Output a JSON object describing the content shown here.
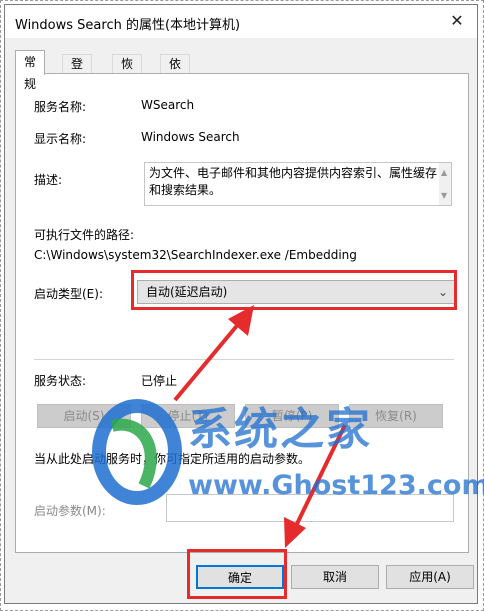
{
  "window": {
    "title": "Windows Search 的属性(本地计算机)"
  },
  "tabs": [
    "常规",
    "登录",
    "恢复",
    "依存关系"
  ],
  "general": {
    "service_name_label": "服务名称:",
    "service_name_value": "WSearch",
    "display_name_label": "显示名称:",
    "display_name_value": "Windows Search",
    "description_label": "描述:",
    "description_value": "为文件、电子邮件和其他内容提供内容索引、属性缓存和搜索结果。",
    "path_label": "可执行文件的路径:",
    "path_value": "C:\\Windows\\system32\\SearchIndexer.exe /Embedding",
    "startup_type_label": "启动类型(E):",
    "startup_type_value": "自动(延迟启动)",
    "service_status_label": "服务状态:",
    "service_status_value": "已停止",
    "start_button": "启动(S)",
    "stop_button": "停止(T)",
    "pause_button": "暂停(P)",
    "resume_button": "恢复(R)",
    "hint_text": "当从此处启动服务时，你可指定所适用的启动参数。",
    "start_params_label": "启动参数(M):"
  },
  "footer": {
    "ok": "确定",
    "cancel": "取消",
    "apply": "应用(A)"
  },
  "watermark": {
    "brand": "系统之家",
    "url": "www.Ghost123.com"
  },
  "colors": {
    "highlight": "#e52b2b",
    "watermark_blue": "#1e6fd0",
    "ok_focus": "#0078d7"
  }
}
